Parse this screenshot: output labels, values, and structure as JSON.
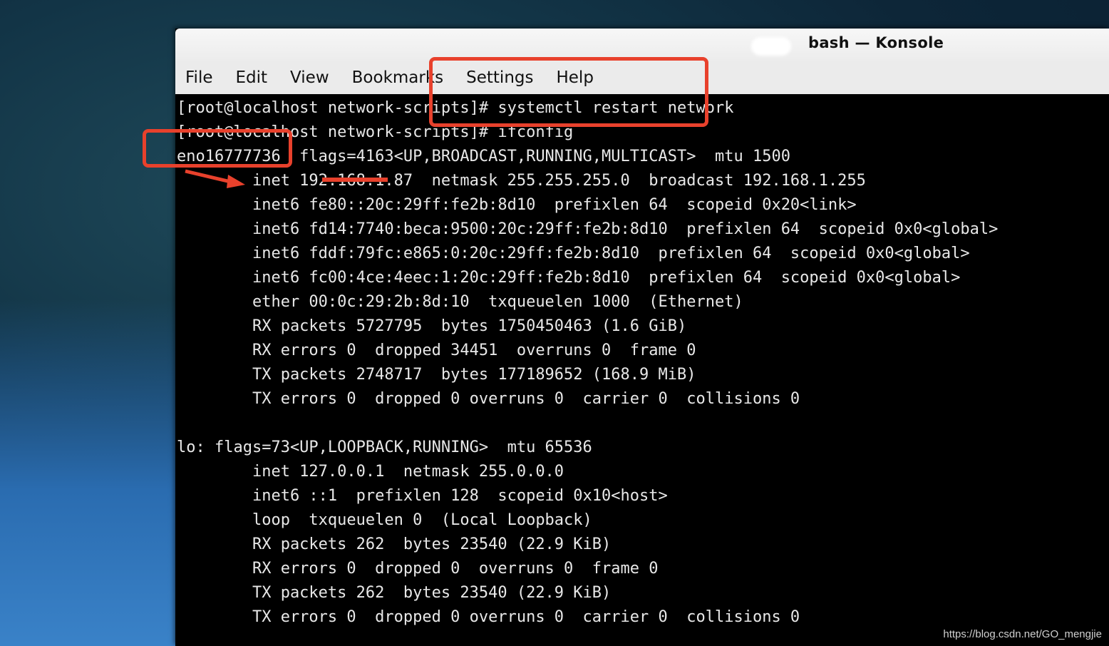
{
  "window": {
    "title": "bash  — Konsole"
  },
  "menu": [
    "File",
    "Edit",
    "View",
    "Bookmarks",
    "Settings",
    "Help"
  ],
  "terminal_lines": [
    "[root@localhost network-scripts]# systemctl restart network",
    "[root@localhost network-scripts]# ifconfig",
    "eno16777736  flags=4163<UP,BROADCAST,RUNNING,MULTICAST>  mtu 1500",
    "        inet 192.168.1.87  netmask 255.255.255.0  broadcast 192.168.1.255",
    "        inet6 fe80::20c:29ff:fe2b:8d10  prefixlen 64  scopeid 0x20<link>",
    "        inet6 fd14:7740:beca:9500:20c:29ff:fe2b:8d10  prefixlen 64  scopeid 0x0<global>",
    "        inet6 fddf:79fc:e865:0:20c:29ff:fe2b:8d10  prefixlen 64  scopeid 0x0<global>",
    "        inet6 fc00:4ce:4eec:1:20c:29ff:fe2b:8d10  prefixlen 64  scopeid 0x0<global>",
    "        ether 00:0c:29:2b:8d:10  txqueuelen 1000  (Ethernet)",
    "        RX packets 5727795  bytes 1750450463 (1.6 GiB)",
    "        RX errors 0  dropped 34451  overruns 0  frame 0",
    "        TX packets 2748717  bytes 177189652 (168.9 MiB)",
    "        TX errors 0  dropped 0 overruns 0  carrier 0  collisions 0",
    "",
    "lo: flags=73<UP,LOOPBACK,RUNNING>  mtu 65536",
    "        inet 127.0.0.1  netmask 255.0.0.0",
    "        inet6 ::1  prefixlen 128  scopeid 0x10<host>",
    "        loop  txqueuelen 0  (Local Loopback)",
    "        RX packets 262  bytes 23540 (22.9 KiB)",
    "        RX errors 0  dropped 0  overruns 0  frame 0",
    "        TX packets 262  bytes 23540 (22.9 KiB)",
    "        TX errors 0  dropped 0 overruns 0  carrier 0  collisions 0"
  ],
  "watermark": "https://blog.csdn.net/GO_mengjie",
  "colors": {
    "annotation": "#e8412c",
    "terminal_bg": "#000000",
    "terminal_fg": "#e8e8e8",
    "menubar_bg": "#ebebeb"
  }
}
